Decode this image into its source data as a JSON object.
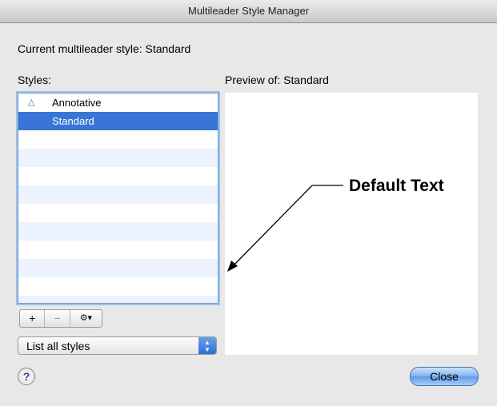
{
  "window": {
    "title": "Multileader Style Manager"
  },
  "current_style": {
    "label": "Current multileader style: Standard"
  },
  "styles": {
    "label": "Styles:",
    "items": [
      {
        "label": "Annotative",
        "icon": "annotative-icon",
        "selected": false
      },
      {
        "label": "Standard",
        "icon": "",
        "selected": true
      }
    ]
  },
  "preview": {
    "label": "Preview of: Standard",
    "sample_text": "Default Text"
  },
  "toolbar": {
    "add_label": "+",
    "remove_label": "−",
    "gear_label": "⚙▾"
  },
  "filter": {
    "selected": "List all styles"
  },
  "buttons": {
    "help_label": "?",
    "close_label": "Close"
  }
}
